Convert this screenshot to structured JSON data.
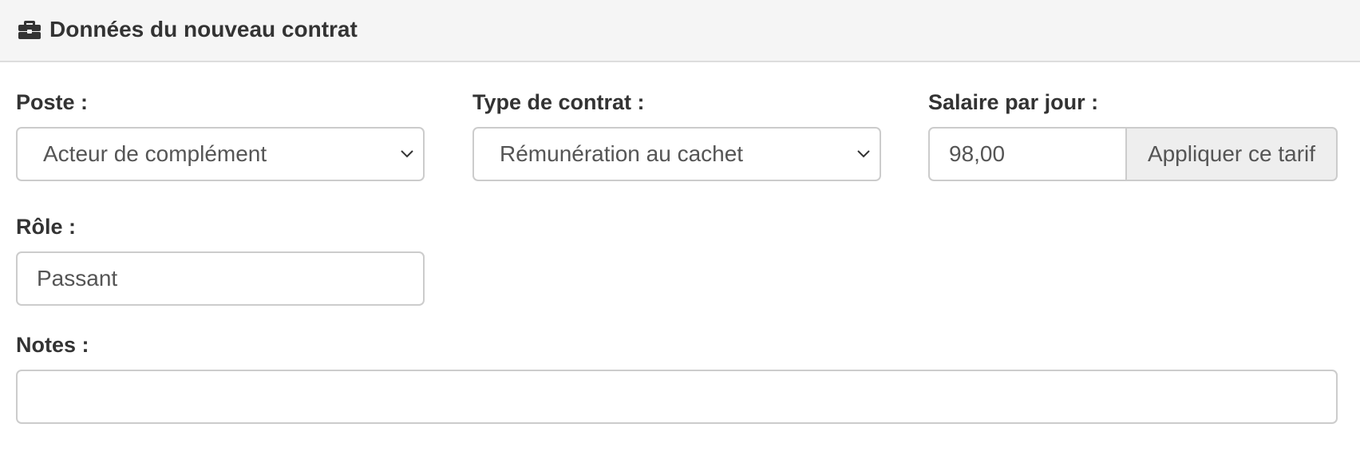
{
  "panel": {
    "title": "Données du nouveau contrat",
    "icon": "briefcase-icon"
  },
  "form": {
    "poste": {
      "label": "Poste :",
      "selected": "Acteur de complément"
    },
    "type_contrat": {
      "label": "Type de contrat :",
      "selected": "Rémunération au cachet"
    },
    "salaire": {
      "label": "Salaire par jour :",
      "value": "98,00",
      "apply_button": "Appliquer ce tarif"
    },
    "role": {
      "label": "Rôle :",
      "value": "Passant"
    },
    "notes": {
      "label": "Notes :",
      "value": ""
    }
  },
  "colors": {
    "heading_bg": "#f5f5f5",
    "border": "#cccccc",
    "text": "#333333",
    "addon_bg": "#eeeeee"
  }
}
